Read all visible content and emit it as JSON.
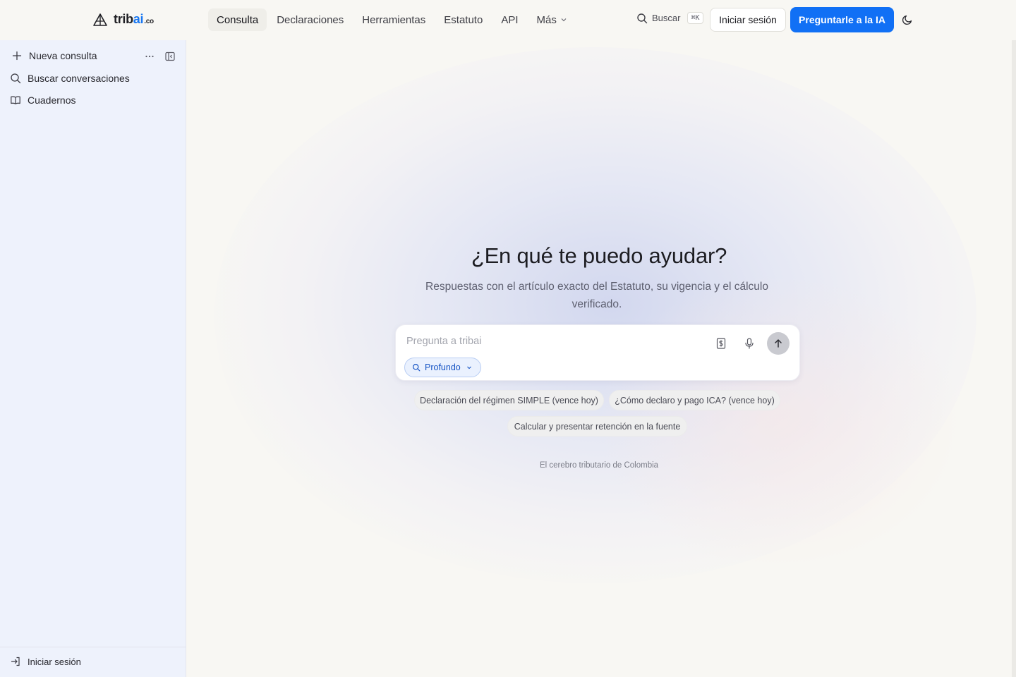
{
  "brand": {
    "name_main": "trib",
    "name_accent": "ai",
    "name_suffix": ".co",
    "accent_color": "#1170f5"
  },
  "nav": {
    "items": [
      {
        "label": "Consulta",
        "active": true
      },
      {
        "label": "Declaraciones"
      },
      {
        "label": "Herramientas"
      },
      {
        "label": "Estatuto"
      },
      {
        "label": "API"
      },
      {
        "label": "Más",
        "has_dropdown": true
      }
    ]
  },
  "header": {
    "search_label": "Buscar",
    "search_shortcut": "⌘K",
    "login_label": "Iniciar sesión",
    "ask_label": "Preguntarle a la IA"
  },
  "sidebar": {
    "new_label": "Nueva consulta",
    "search_label": "Buscar conversaciones",
    "notebooks_label": "Cuadernos",
    "login_label": "Iniciar sesión"
  },
  "main": {
    "headline": "¿En qué te puedo ayudar?",
    "subtitle": "Respuestas con el artículo exacto del Estatuto, su vigencia y el cálculo verificado.",
    "input_placeholder": "Pregunta a tribai",
    "mode_label": "Profundo",
    "suggestions": [
      "Declaración del régimen SIMPLE (vence hoy)",
      "¿Cómo declaro y pago ICA? (vence hoy)",
      "Calcular y presentar retención en la fuente"
    ],
    "tagline": "El cerebro tributario de Colombia"
  }
}
